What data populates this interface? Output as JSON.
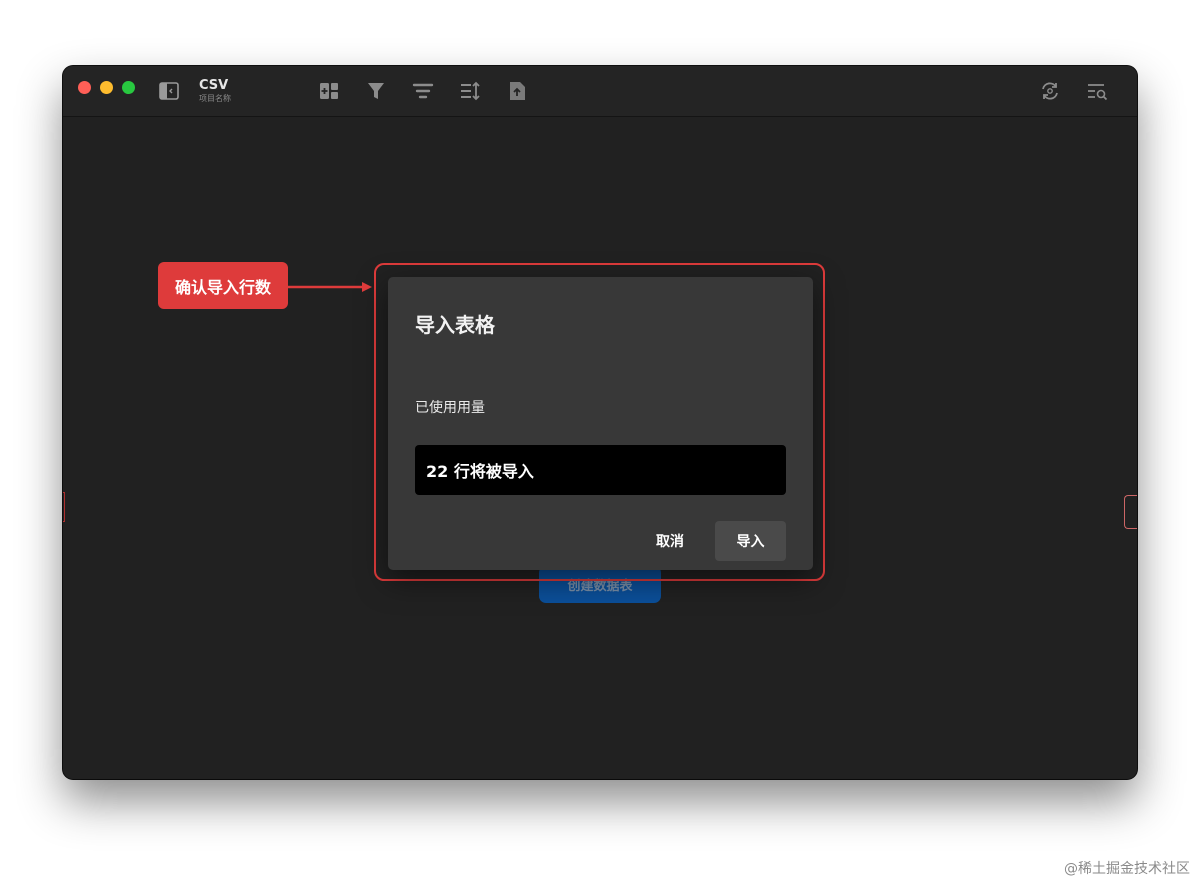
{
  "window": {
    "app_title": "CSV",
    "app_subtitle": "项目名称",
    "toolbar_icons": [
      "sidebar-toggle-icon",
      "add-field-icon",
      "filter-icon",
      "group-icon",
      "sort-icon",
      "export-file-icon",
      "sync-icon",
      "search-list-icon"
    ]
  },
  "background": {
    "create_table_label": "创建数据表"
  },
  "dialog": {
    "title": "导入表格",
    "usage_label": "已使用用量",
    "rows_message": "22 行将被导入",
    "cancel_label": "取消",
    "import_label": "导入"
  },
  "annotation": {
    "callout_label": "确认导入行数",
    "accent_color": "#de3b3b"
  },
  "watermark": "@稀土掘金技术社区"
}
